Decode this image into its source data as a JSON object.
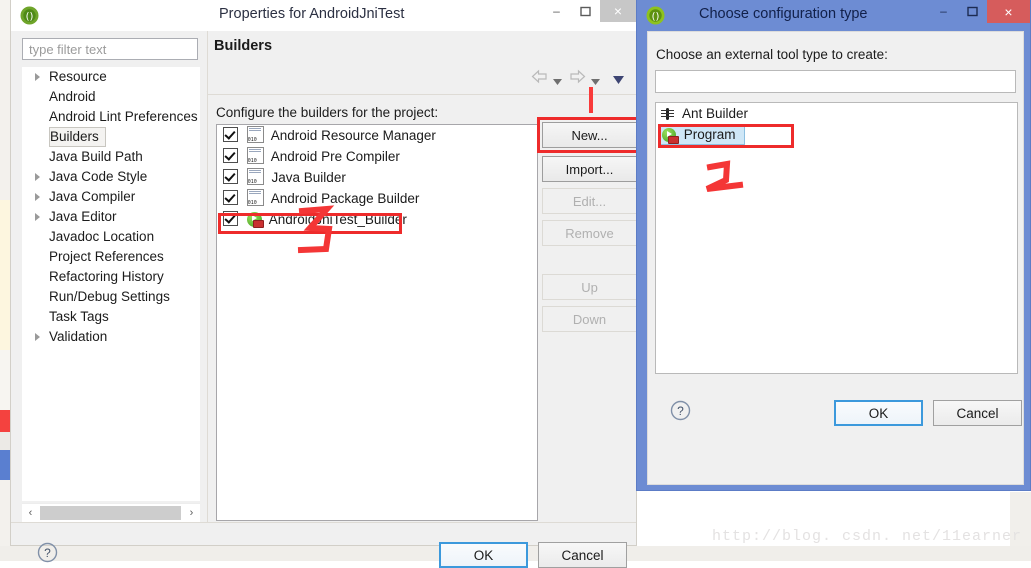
{
  "background": {
    "bottom_text": "",
    "watermark": "http://blog. csdn. net/11earner"
  },
  "properties_dialog": {
    "title": "Properties for AndroidJniTest",
    "icon": "eclipse-icon",
    "window_buttons": {
      "minimize": "–",
      "maximize": "❐",
      "close": "×"
    },
    "filter": {
      "placeholder": "type filter text",
      "value": ""
    },
    "tree": {
      "items": [
        {
          "label": "Resource",
          "expandable": true,
          "selected": false
        },
        {
          "label": "Android",
          "expandable": false,
          "selected": false
        },
        {
          "label": "Android Lint Preferences",
          "expandable": false,
          "selected": false
        },
        {
          "label": "Builders",
          "expandable": false,
          "selected": true
        },
        {
          "label": "Java Build Path",
          "expandable": false,
          "selected": false
        },
        {
          "label": "Java Code Style",
          "expandable": true,
          "selected": false
        },
        {
          "label": "Java Compiler",
          "expandable": true,
          "selected": false
        },
        {
          "label": "Java Editor",
          "expandable": true,
          "selected": false
        },
        {
          "label": "Javadoc Location",
          "expandable": false,
          "selected": false
        },
        {
          "label": "Project References",
          "expandable": false,
          "selected": false
        },
        {
          "label": "Refactoring History",
          "expandable": false,
          "selected": false
        },
        {
          "label": "Run/Debug Settings",
          "expandable": false,
          "selected": false
        },
        {
          "label": "Task Tags",
          "expandable": false,
          "selected": false
        },
        {
          "label": "Validation",
          "expandable": true,
          "selected": false
        }
      ],
      "hscroll": {
        "left_arrow": "‹",
        "right_arrow": "›"
      }
    },
    "page": {
      "heading": "Builders",
      "nav": {
        "back": "back-arrow-icon",
        "back_menu": "chevron-down-icon",
        "forward": "forward-arrow-icon",
        "forward_menu": "chevron-down-icon",
        "more": "chevron-down-icon"
      },
      "description": "Configure the builders for the project:",
      "builders": [
        {
          "label": "Android Resource Manager",
          "checked": true,
          "icon": "builder-doc-icon",
          "highlighted": false
        },
        {
          "label": "Android Pre Compiler",
          "checked": true,
          "icon": "builder-doc-icon",
          "highlighted": false
        },
        {
          "label": "Java Builder",
          "checked": true,
          "icon": "builder-doc-icon",
          "highlighted": false
        },
        {
          "label": "Android Package Builder",
          "checked": true,
          "icon": "builder-doc-icon",
          "highlighted": false
        },
        {
          "label": "AndroidJniTest_Builder",
          "checked": true,
          "icon": "program-builder-icon",
          "highlighted": true
        }
      ],
      "buttons": [
        {
          "label": "New...",
          "enabled": true,
          "highlighted": true
        },
        {
          "label": "Import...",
          "enabled": true,
          "highlighted": false
        },
        {
          "label": "Edit...",
          "enabled": false,
          "highlighted": false
        },
        {
          "label": "Remove",
          "enabled": false,
          "highlighted": false
        },
        {
          "label": "Up",
          "enabled": false,
          "highlighted": false
        },
        {
          "label": "Down",
          "enabled": false,
          "highlighted": false
        }
      ]
    },
    "footer": {
      "help": "?",
      "ok": "OK",
      "cancel": "Cancel"
    }
  },
  "choose_config_dialog": {
    "title": "Choose configuration type",
    "icon": "eclipse-icon",
    "window_buttons": {
      "minimize": "–",
      "maximize": "❐",
      "close": "×"
    },
    "prompt": "Choose an external tool type to create:",
    "search": {
      "value": "",
      "placeholder": ""
    },
    "types": [
      {
        "label": "Ant Builder",
        "icon": "ant-icon",
        "selected": false,
        "highlighted": false
      },
      {
        "label": "Program",
        "icon": "program-icon",
        "selected": true,
        "highlighted": true
      }
    ],
    "footer": {
      "help": "?",
      "ok": "OK",
      "cancel": "Cancel"
    }
  },
  "annotations": [
    {
      "name": "step-1-marker",
      "text": "1",
      "shape": "vertical-tick"
    },
    {
      "name": "step-2-marker",
      "text": "2",
      "shape": "handwritten"
    },
    {
      "name": "step-3-marker",
      "text": "3",
      "shape": "handwritten"
    }
  ],
  "colors": {
    "active_title": "#6d8cd3",
    "annotation_red": "#ee2b2b",
    "close_red": "#d65c5c",
    "focus_blue": "#3c99dc",
    "selection_blue": "#cfe7f7"
  }
}
